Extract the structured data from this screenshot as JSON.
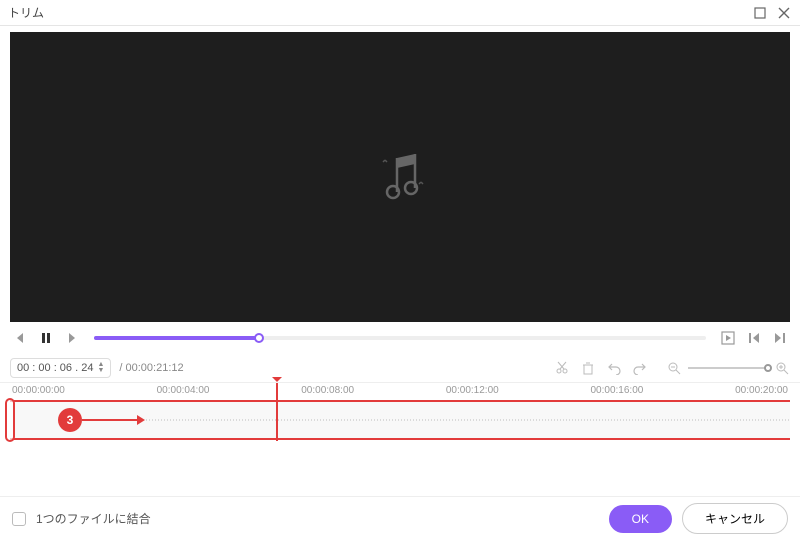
{
  "window": {
    "title": "トリム"
  },
  "timecode": {
    "current": "00 : 00 : 06 . 24",
    "duration": "/ 00:00:21:12"
  },
  "ruler": [
    "00:00:00:00",
    "00:00:04:00",
    "00:00:08:00",
    "00:00:12:00",
    "00:00:16:00",
    "00:00:20:00"
  ],
  "annotation": {
    "badge": "3"
  },
  "footer": {
    "merge_label": "1つのファイルに結合",
    "ok_label": "OK",
    "cancel_label": "キャンセル"
  }
}
